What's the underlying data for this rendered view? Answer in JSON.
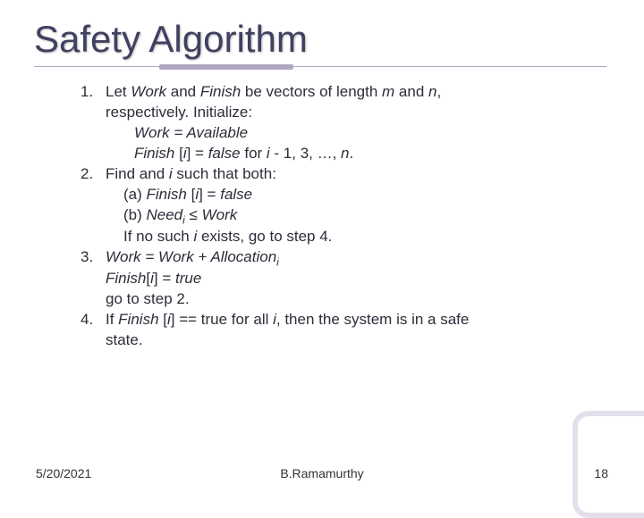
{
  "title": "Safety Algorithm",
  "items": {
    "n1": "1.",
    "n2": "2.",
    "n3": "3.",
    "n4": "4.",
    "l1a": "Let ",
    "l1b": " and ",
    "l1c": " be vectors of length ",
    "l1d": " and ",
    "l1e": ",",
    "l1f": "respectively.  Initialize:",
    "work": "Work",
    "finish": "Finish",
    "m": "m",
    "n": "n",
    "eq1": "Work = Available",
    "eq2a": "Finish ",
    "eq2b": "[",
    "eq2c": "] = ",
    "eq2d": "false ",
    "eq2e": "for ",
    "eq2f": " - 1, 3, …, ",
    "eq2g": ".",
    "i": "i",
    "l2a": "Find and ",
    "l2b": " such that both:",
    "l2c": "(a) ",
    "l2d": "[",
    "l2e": "] = ",
    "l2f": "false",
    "l2g": "(b) ",
    "need": "Need",
    "le": " ≤ ",
    "l2h": "If no such ",
    "l2i": " exists, go to step 4.",
    "l3a": "Work = Work + Allocation",
    "l3b": "[",
    "l3c": "] = ",
    "l3d": "true",
    "l3e": "go to step 2.",
    "l4a": "If ",
    "l4b": " [",
    "l4c": "] == true for all ",
    "l4d": ", then the system is in a safe",
    "l4e": "state."
  },
  "footer": {
    "date": "5/20/2021",
    "author": "B.Ramamurthy",
    "page": "18"
  }
}
